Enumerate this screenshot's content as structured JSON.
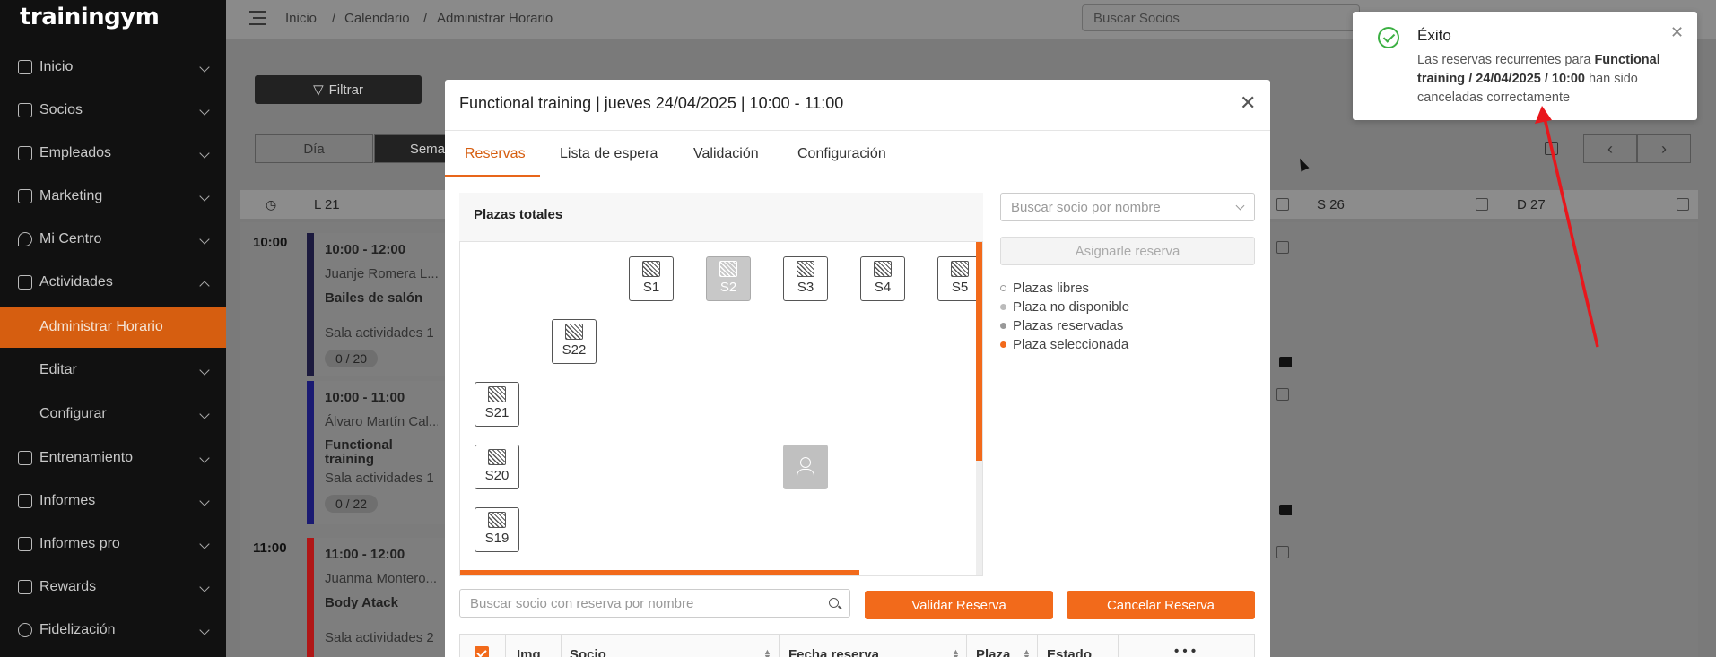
{
  "app": {
    "logo": "trainingym"
  },
  "sidebar": {
    "items": [
      {
        "label": "Inicio",
        "icon": "home-icon"
      },
      {
        "label": "Socios",
        "icon": "members-icon"
      },
      {
        "label": "Empleados",
        "icon": "employees-icon"
      },
      {
        "label": "Marketing",
        "icon": "megaphone-icon"
      },
      {
        "label": "Mi Centro",
        "icon": "location-icon"
      },
      {
        "label": "Actividades",
        "icon": "calendar-icon"
      },
      {
        "label": "Administrar Horario"
      },
      {
        "label": "Editar"
      },
      {
        "label": "Configurar"
      },
      {
        "label": "Entrenamiento",
        "icon": "training-icon"
      },
      {
        "label": "Informes",
        "icon": "chart-icon"
      },
      {
        "label": "Informes pro",
        "icon": "chart-pro-icon"
      },
      {
        "label": "Rewards",
        "icon": "rewards-icon"
      },
      {
        "label": "Fidelización",
        "icon": "heart-icon"
      }
    ]
  },
  "breadcrumb": [
    "Inicio",
    "Calendario",
    "Administrar Horario"
  ],
  "top_search": {
    "placeholder": "Buscar Socios"
  },
  "calendar": {
    "filter_label": "Filtrar",
    "view_day": "Día",
    "view_week": "Sema",
    "days": [
      "L 21",
      "S 26",
      "D 27"
    ],
    "hours": [
      "10:00",
      "11:00"
    ],
    "events": [
      {
        "time": "10:00 - 12:00",
        "trainer": "Juanje Romera L...",
        "activity": "Bailes de salón",
        "room": "Sala actividades 1",
        "count": "0 / 20"
      },
      {
        "time": "10:00 - 11:00",
        "trainer": "Álvaro Martín Cal...",
        "activity": "Functional training",
        "room": "Sala actividades 1",
        "count": "0 / 22"
      },
      {
        "time": "11:00 - 12:00",
        "trainer": "Juanma Montero...",
        "activity": "Body Atack",
        "room": "Sala actividades 2"
      }
    ]
  },
  "modal": {
    "title": "Functional training | jueves 24/04/2025 | 10:00 - 11:00",
    "tabs": [
      "Reservas",
      "Lista de espera",
      "Validación",
      "Configuración"
    ],
    "plazas_title": "Plazas totales",
    "seats": [
      "S1",
      "S2",
      "S3",
      "S4",
      "S5",
      "S22",
      "S21",
      "S20",
      "S19"
    ],
    "search_socio_placeholder": "Buscar socio por nombre",
    "assign_label": "Asignarle reserva",
    "legend": [
      {
        "label": "Plazas libres",
        "color": "#ffffff"
      },
      {
        "label": "Plaza no disponible",
        "color": "#bbbbbb"
      },
      {
        "label": "Plazas reservadas",
        "color": "#999999"
      },
      {
        "label": "Plaza seleccionada",
        "color": "#f26a1b"
      }
    ],
    "search_reserva_placeholder": "Buscar socio con reserva por nombre",
    "validar_label": "Validar Reserva",
    "cancelar_label": "Cancelar Reserva",
    "columns": [
      "Img",
      "Socio",
      "Fecha reserva",
      "Plaza",
      "Estado",
      "• • •"
    ]
  },
  "toast": {
    "title": "Éxito",
    "msg_pre": "Las reservas recurrentes para ",
    "msg_bold": "Functional training / 24/04/2025 / 10:00",
    "msg_post": " han sido canceladas correctamente"
  },
  "colors": {
    "accent": "#f26a1b",
    "success": "#3cb043",
    "annotation_arrow": "#e8171c"
  }
}
